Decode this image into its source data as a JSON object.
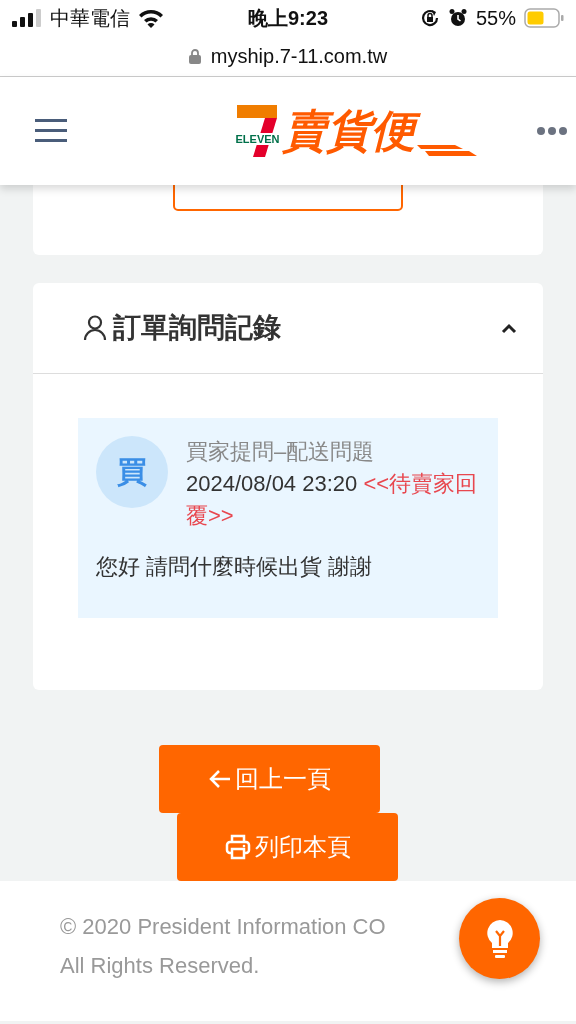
{
  "status_bar": {
    "carrier": "中華電信",
    "time": "晚上9:23",
    "battery": "55%"
  },
  "address_bar": {
    "url": "myship.7-11.com.tw"
  },
  "header": {
    "logo_brand": "ELEVEN",
    "logo_text": "賣貨便"
  },
  "inquiry_card": {
    "title": "訂單詢問記錄",
    "expanded": true,
    "messages": [
      {
        "avatar": "買",
        "subject": "買家提問–配送問題",
        "time": "2024/08/04 23:20",
        "status": "<<待賣家回覆>>",
        "body": "您好 請問什麼時候出貨 謝謝"
      }
    ]
  },
  "buttons": [
    {
      "kind": "back",
      "label": "回上一頁"
    },
    {
      "kind": "print",
      "label": "列印本頁"
    }
  ],
  "footer": {
    "lines": [
      "© 2020 President Information CO",
      "All Rights Reserved."
    ]
  }
}
